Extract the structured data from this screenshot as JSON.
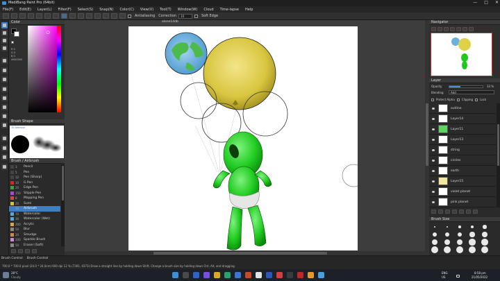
{
  "window": {
    "title": "MediBang Paint Pro (64bit)",
    "min": "—",
    "max": "□",
    "close": "✕"
  },
  "menu": [
    "File(F)",
    "Edit(E)",
    "Layer(L)",
    "Filter(F)",
    "Select(S)",
    "Snap(N)",
    "Color(C)",
    "View(V)",
    "Tool(T)",
    "Window(W)",
    "Cloud",
    "Time-lapse",
    "Help"
  ],
  "toolbar": {
    "antialias_label": "Antialiasing",
    "correction_label": "Correction",
    "correction_value": "10",
    "softedge_label": "Soft Edge"
  },
  "color_panel": {
    "title": "Color",
    "hex": "#000000",
    "values": [
      "R 0",
      "G 0",
      "B 0"
    ],
    "fg": "#000000",
    "bg": "#ffffff"
  },
  "brush_shape": {
    "title": "Brush Shape",
    "subtitle": "10 Airbrush"
  },
  "brush_list": {
    "title": "Brush / Airbrush",
    "items": [
      {
        "size": "3",
        "name": "Pencil",
        "color": "#444444"
      },
      {
        "size": "5",
        "name": "Pen",
        "color": "#444444"
      },
      {
        "size": "12",
        "name": "Pen (Sharp)",
        "color": "#444444"
      },
      {
        "size": "10",
        "name": "G Pen",
        "color": "#ce2a2a"
      },
      {
        "size": "20",
        "name": "Edge Pen",
        "color": "#3ea33e"
      },
      {
        "size": "150",
        "name": "Stipple Pen",
        "color": "#a04be0"
      },
      {
        "size": "8",
        "name": "Mapping Pen",
        "color": "#d64545"
      },
      {
        "size": "20",
        "name": "Sumi",
        "color": "#d4c22e"
      },
      {
        "size": "30",
        "name": "Airbrush",
        "color": "#3f7fbf"
      },
      {
        "size": "70",
        "name": "Watercolor",
        "color": "#59a6d6"
      },
      {
        "size": "30",
        "name": "Watercolor (Wet)",
        "color": "#59a6d6"
      },
      {
        "size": "200",
        "name": "Acrylic",
        "color": "#e0a34c"
      },
      {
        "size": "50",
        "name": "Blur",
        "color": "#888888"
      },
      {
        "size": "20",
        "name": "Smudge",
        "color": "#c98b4a"
      },
      {
        "size": "100",
        "name": "Sparkle Brush",
        "color": "#c98bd6"
      },
      {
        "size": "50",
        "name": "Eraser (Soft)",
        "color": "#888888"
      }
    ],
    "selected_index": 8
  },
  "canvas": {
    "tab_label": "alone14db"
  },
  "navigator": {
    "title": "Navigator"
  },
  "layers": {
    "title": "Layer",
    "opacity_label": "Opacity",
    "opacity_value": "33 %",
    "opacity_fraction": 0.33,
    "blending_label": "Blending",
    "blending_value": "Add",
    "protect_alpha": "Protect Alpha",
    "clipping": "Clipping",
    "lock": "Lock",
    "items": [
      {
        "name": "outline",
        "thumb": "#ffffff"
      },
      {
        "name": "Layer14",
        "thumb": "#ffffff"
      },
      {
        "name": "Layer11",
        "thumb": "#5fd35f"
      },
      {
        "name": "Layer13",
        "thumb": "#ffffff"
      },
      {
        "name": "string",
        "thumb": "#ffffff"
      },
      {
        "name": "circles",
        "thumb": "#ffffff"
      },
      {
        "name": "earth",
        "thumb": "#ffffff"
      },
      {
        "name": "Layer15",
        "thumb": "#f3e7a0"
      },
      {
        "name": "violet planet",
        "thumb": "#ffffff"
      },
      {
        "name": "pink planet",
        "thumb": "#ffffff"
      }
    ]
  },
  "brush_size": {
    "title": "Brush Size"
  },
  "status": {
    "tabs": [
      "Brush Control",
      "Brush Control"
    ],
    "info": "700.0 * 700.0 pixel (24.0 * 24.0cm) 600 dpi 12 % (7301, 4373) Draw a straight line by holding down Shift, Change a brush size by holding down Ctrl, Alt, and dragging."
  },
  "taskbar": {
    "weather_temp": "28°C",
    "weather_text": "Cloudy",
    "lang": "ENG",
    "region": "US",
    "time": "8:58 pm",
    "date": "21/05/2022"
  },
  "colors": {
    "alien": "#1ec81e",
    "balloon_yellow": "#e0d14a",
    "earth_blue": "#6ab1de",
    "earth_green": "#4cbb4c"
  }
}
